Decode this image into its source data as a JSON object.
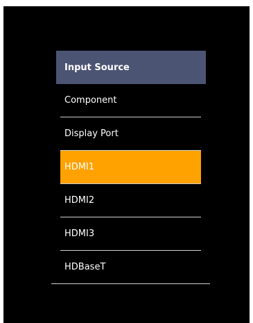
{
  "menu": {
    "title": "Input Source",
    "items": [
      {
        "label": "Component",
        "selected": false
      },
      {
        "label": "Display Port",
        "selected": false
      },
      {
        "label": "HDMI1",
        "selected": true
      },
      {
        "label": "HDMI2",
        "selected": false
      },
      {
        "label": "HDMI3",
        "selected": false
      },
      {
        "label": "HDBaseT",
        "selected": false
      }
    ]
  },
  "colors": {
    "background": "#000000",
    "header": "#4c5474",
    "selected": "#ffa200",
    "text": "#ffffff",
    "divider": "#cfcfcf"
  }
}
